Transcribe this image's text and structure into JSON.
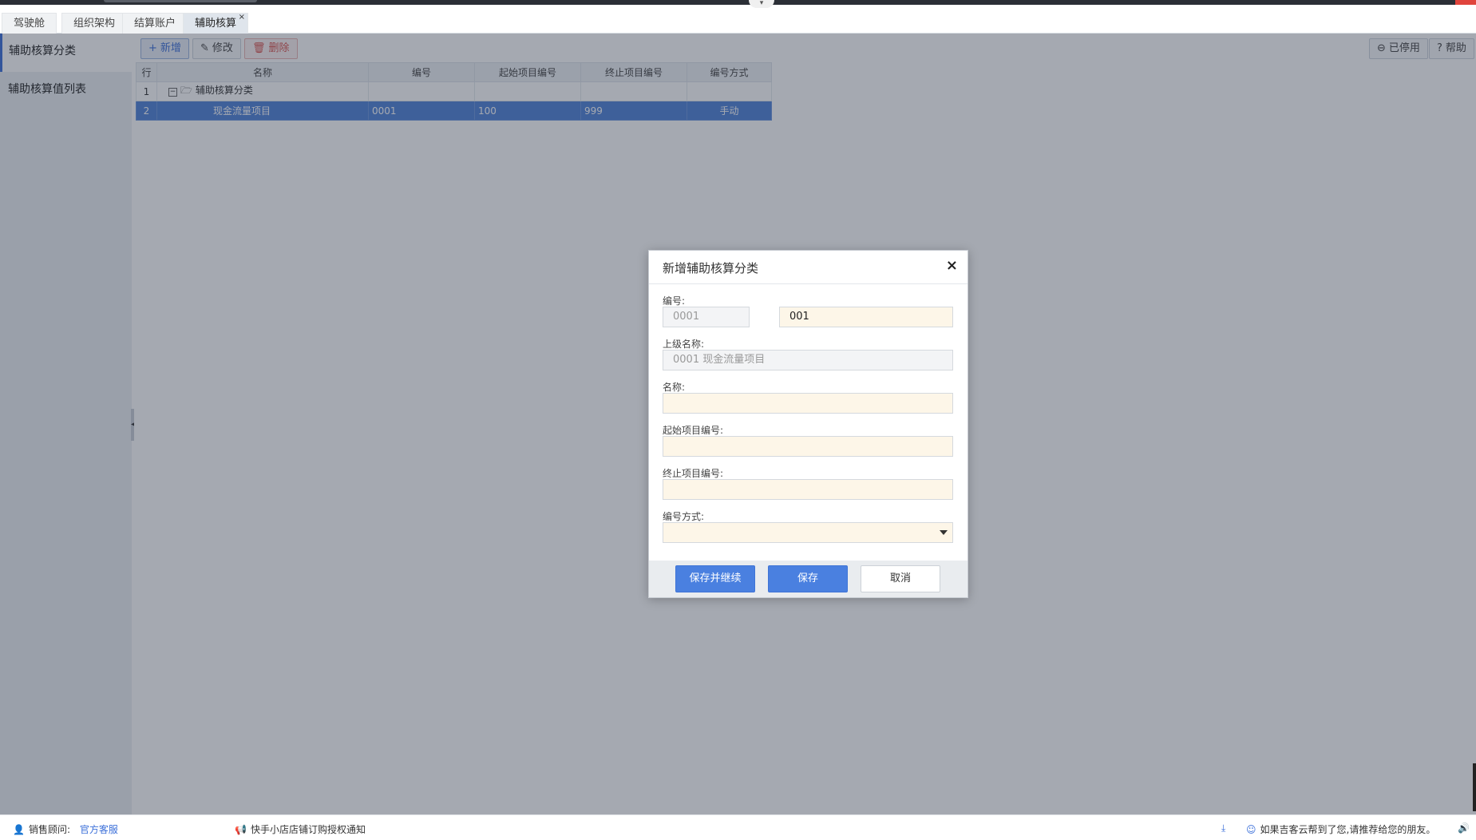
{
  "tabs": [
    {
      "label": "驾驶舱"
    },
    {
      "label": "组织架构"
    },
    {
      "label": "结算账户"
    },
    {
      "label": "辅助核算",
      "close": "×"
    }
  ],
  "sidebar": {
    "items": [
      {
        "label": "辅助核算分类"
      },
      {
        "label": "辅助核算值列表"
      }
    ]
  },
  "toolbar": {
    "add_label": "新增",
    "edit_label": "修改",
    "delete_label": "删除",
    "disabled_label": "已停用",
    "help_label": "帮助"
  },
  "table": {
    "headers": [
      "行",
      "名称",
      "编号",
      "起始项目编号",
      "终止项目编号",
      "编号方式"
    ],
    "rows": [
      {
        "row": "1",
        "name": "辅助核算分类",
        "code": "",
        "start": "",
        "end": "",
        "mode": ""
      },
      {
        "row": "2",
        "name": "现金流量项目",
        "code": "0001",
        "start": "100",
        "end": "999",
        "mode": "手动"
      }
    ]
  },
  "dialog": {
    "title": "新增辅助核算分类",
    "close": "×",
    "code_label": "编号:",
    "code_prefix": "0001",
    "code_value": "001",
    "parent_label": "上级名称:",
    "parent_value": "0001 现金流量项目",
    "name_label": "名称:",
    "name_value": "",
    "start_label": "起始项目编号:",
    "start_value": "",
    "end_label": "终止项目编号:",
    "end_value": "",
    "mode_label": "编号方式:",
    "mode_value": "",
    "save_continue": "保存并继续",
    "save": "保存",
    "cancel": "取消"
  },
  "footer": {
    "advisor_label": "销售顾问:",
    "advisor_link": "官方客服",
    "notice": "快手小店店铺订购授权通知",
    "recommend": "如果吉客云帮到了您,请推荐给您的朋友。"
  },
  "colors": {
    "accent": "#4a80e0",
    "selected_row": "#4f82d8",
    "input_bg": "#fdf6e8"
  }
}
